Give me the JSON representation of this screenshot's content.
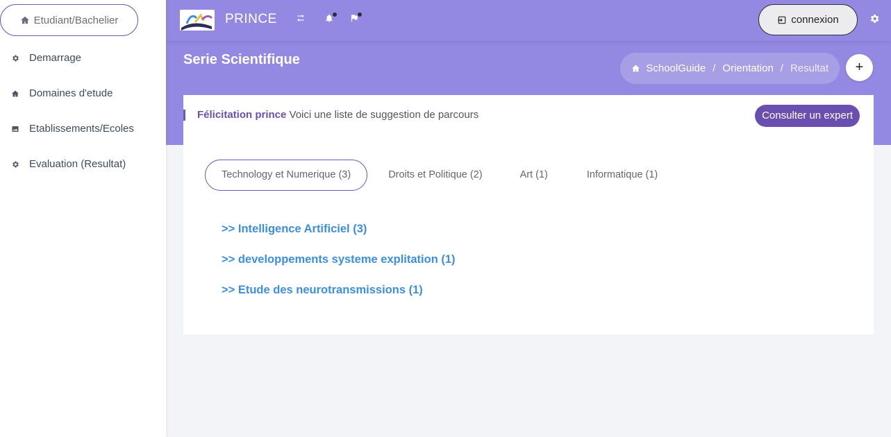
{
  "sidebar": {
    "role_label": "Etudiant/Bachelier",
    "items": [
      {
        "label": "Demarrage",
        "icon": "gear-icon"
      },
      {
        "label": "Domaines d'etude",
        "icon": "home-icon"
      },
      {
        "label": "Etablissements/Ecoles",
        "icon": "image-icon"
      },
      {
        "label": "Evaluation (Resultat)",
        "icon": "gear-icon"
      }
    ]
  },
  "topbar": {
    "brand": "PRINCE",
    "connexion_label": "connexion"
  },
  "header": {
    "title": "Serie Scientifique",
    "breadcrumb": [
      "SchoolGuide",
      "Orientation",
      "Resultat"
    ],
    "add_label": "+"
  },
  "card": {
    "greeting_bold": "Félicitation prince",
    "greeting_text": " Voici une liste de suggestion de parcours",
    "expert_label": "Consulter un expert",
    "tabs": [
      {
        "label": "Technology et Numerique (3)",
        "active": true
      },
      {
        "label": "Droits et Politique (2)",
        "active": false
      },
      {
        "label": "Art (1)",
        "active": false
      },
      {
        "label": "Informatique (1)",
        "active": false
      }
    ],
    "results": [
      ">> Intelligence Artificiel (3)",
      ">> developpements systeme explitation (1)",
      ">> Etude des neurotransmissions (1)"
    ]
  },
  "colors": {
    "accent": "#9389e2",
    "primary": "#6a4fb0",
    "link": "#3b8fe0"
  }
}
